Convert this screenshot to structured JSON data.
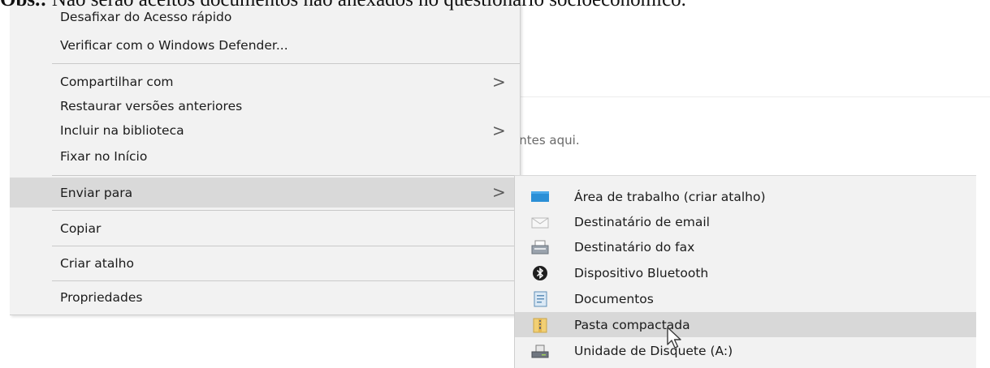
{
  "caption": {
    "bold": "Obs.:",
    "text": " Não serão aceitos documentos não anexados no questionário socioeconômico."
  },
  "background": {
    "hint_text": "entes aqui."
  },
  "context_menu": {
    "items": [
      {
        "label": "Desafixar do Acesso rápido"
      },
      {
        "label": "Verificar com o Windows Defender..."
      },
      {
        "label": "Compartilhar com",
        "arrow": ">"
      },
      {
        "label": "Restaurar versões anteriores"
      },
      {
        "label": "Incluir na biblioteca",
        "arrow": ">"
      },
      {
        "label": "Fixar no Início"
      },
      {
        "label": "Enviar para",
        "arrow": ">",
        "highlighted": true
      },
      {
        "label": "Copiar"
      },
      {
        "label": "Criar atalho"
      },
      {
        "label": "Propriedades"
      }
    ]
  },
  "submenu": {
    "items": [
      {
        "label": "Área de trabalho (criar atalho)",
        "icon": "desktop-icon"
      },
      {
        "label": "Destinatário de email",
        "icon": "mail-recipient-icon"
      },
      {
        "label": "Destinatário do fax",
        "icon": "fax-icon"
      },
      {
        "label": "Dispositivo Bluetooth",
        "icon": "bluetooth-icon"
      },
      {
        "label": "Documentos",
        "icon": "documents-icon"
      },
      {
        "label": "Pasta compactada",
        "icon": "zip-folder-icon",
        "highlighted": true
      },
      {
        "label": "Unidade de Disquete (A:)",
        "icon": "floppy-drive-icon"
      }
    ]
  },
  "colors": {
    "menu_background": "#f2f2f2",
    "highlight": "#d9d9d9",
    "separator": "#c9c9c9",
    "desktop_blue": "#2b8fd6"
  }
}
